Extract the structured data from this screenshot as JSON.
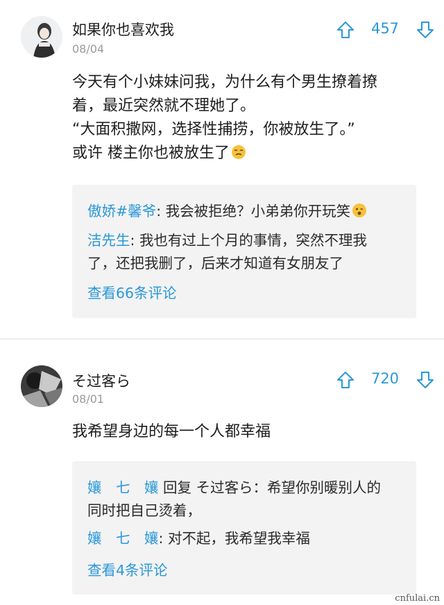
{
  "posts": [
    {
      "username": "如果你也喜欢我",
      "date": "08/04",
      "votes": "457",
      "body": [
        "今天有个小妹妹问我，为什么有个男生撩着撩",
        "着，最近突然就不理她了。",
        "“大面积撒网，选择性捕捞，你被放生了。”",
        "或许 楼主你也被放生了"
      ],
      "replies": [
        {
          "name": "傲娇#馨爷",
          "sep": ": ",
          "text": "我会被拒绝？小弟弟你开玩笑"
        },
        {
          "name": "洁先生",
          "sep": ": ",
          "text": "我也有过上个月的事情，突然不理我",
          "cont": "了，还把我删了，后来才知道有女朋友了"
        }
      ],
      "view_more": "查看66条评论"
    },
    {
      "username": "そ过客ら",
      "date": "08/01",
      "votes": "720",
      "body": [
        "我希望身边的每一个人都幸福"
      ],
      "replies": [
        {
          "name": "孃　七　孃",
          "mid": " 回复 ",
          "target": "そ过客ら",
          "sep": "：",
          "text": "希望你别暖别人的",
          "cont": "同时把自己烫着，"
        },
        {
          "name": "孃　七　孃",
          "sep": ": ",
          "text": "对不起，我希望我幸福"
        }
      ],
      "view_more": "查看4条评论"
    }
  ],
  "icons": {
    "upvote": "arrow-up-icon",
    "downvote": "arrow-down-icon",
    "emoji_post": "tired-face-emoji",
    "emoji_reply": "winking-face-emoji"
  },
  "colors": {
    "accent": "#2a98d8",
    "reply_bg": "#f3f3f3",
    "date": "#9a9a9a",
    "divider": "#ececec"
  },
  "watermark": "cnfulai.cn"
}
